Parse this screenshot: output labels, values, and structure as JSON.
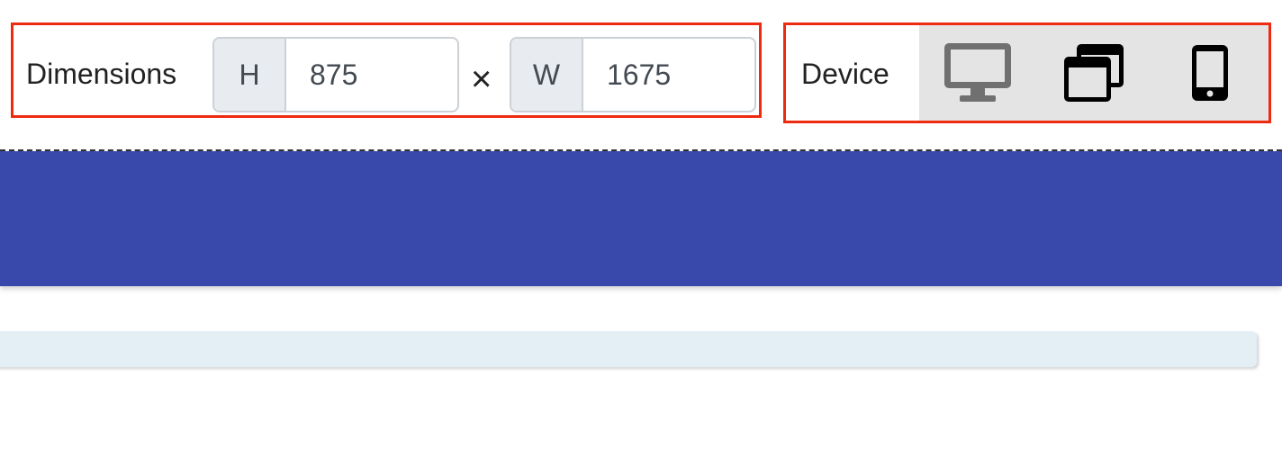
{
  "toolbar": {
    "dimensions": {
      "label": "Dimensions",
      "height": {
        "prefix": "H",
        "value": "875"
      },
      "times_symbol": "×",
      "width": {
        "prefix": "W",
        "value": "1675"
      }
    },
    "device": {
      "label": "Device",
      "options": [
        {
          "name": "desktop",
          "icon": "desktop-monitor-icon",
          "selected": true
        },
        {
          "name": "tablet",
          "icon": "window-stack-icon",
          "selected": false
        },
        {
          "name": "mobile",
          "icon": "mobile-phone-icon",
          "selected": false
        }
      ]
    }
  },
  "colors": {
    "highlight_border": "#ee2a10",
    "banner": "#3949ab",
    "info_bar": "#e3eff5",
    "device_switch_bg": "#e4e4e4",
    "selected_icon": "#707070",
    "icon": "#000000"
  }
}
